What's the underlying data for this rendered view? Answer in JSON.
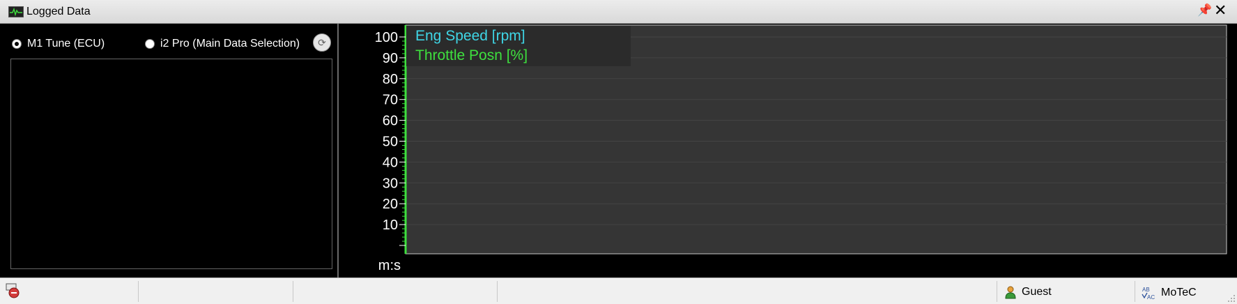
{
  "window": {
    "title": "Logged Data",
    "pin_icon": "pin-icon",
    "close_icon": "close-icon"
  },
  "left_panel": {
    "sources": [
      {
        "label": "M1 Tune (ECU)",
        "selected": true
      },
      {
        "label": "i2 Pro (Main Data Selection)",
        "selected": false
      }
    ],
    "refresh_icon": "refresh-icon"
  },
  "chart": {
    "x_axis_label": "m:s",
    "y_tick_labels": [
      "100",
      "90",
      "80",
      "70",
      "60",
      "50",
      "40",
      "30",
      "20",
      "10"
    ]
  },
  "chart_data": {
    "type": "line",
    "title": "",
    "xlabel": "m:s",
    "ylabel": "",
    "ylim": [
      0,
      100
    ],
    "yticks": [
      10,
      20,
      30,
      40,
      50,
      60,
      70,
      80,
      90,
      100
    ],
    "grid": true,
    "legend_position": "top-left",
    "series": [
      {
        "name": "Eng Speed [rpm]",
        "color": "#3fd6e6",
        "values": []
      },
      {
        "name": "Throttle Posn [%]",
        "color": "#3ee03e",
        "values": []
      }
    ]
  },
  "status_bar": {
    "user": "Guest",
    "organization": "MoTeC"
  },
  "colors": {
    "axis": "#3ee03e",
    "plot_background": "#353535",
    "panel_background": "#000000"
  }
}
